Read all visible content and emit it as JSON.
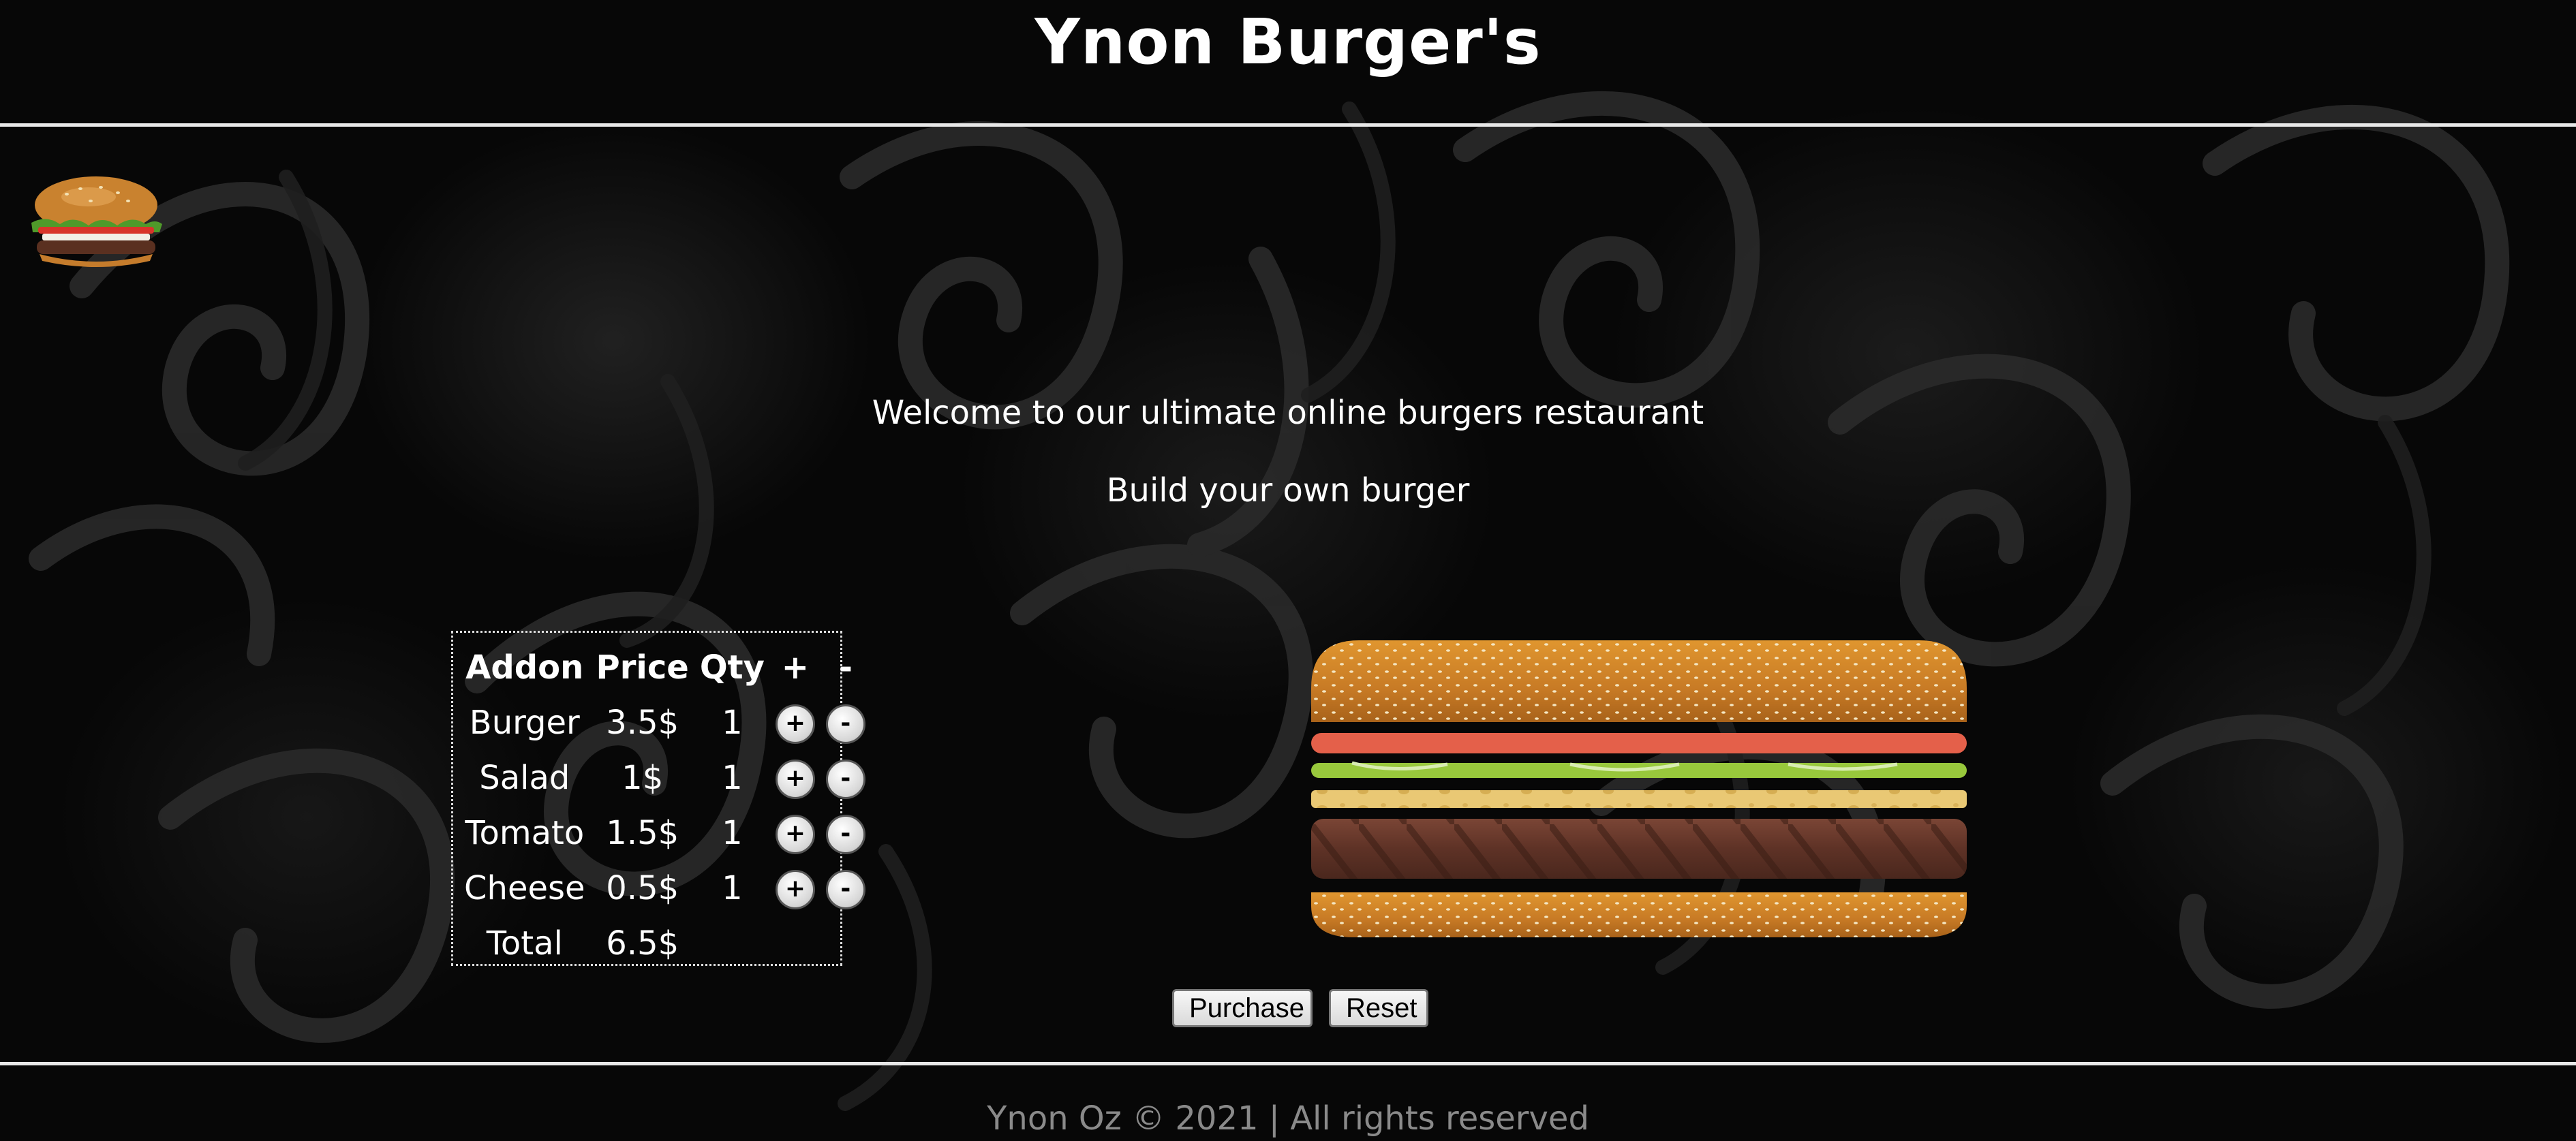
{
  "header": {
    "title": "Ynon Burger's"
  },
  "logo": {
    "icon": "burger-logo-icon"
  },
  "intro": {
    "welcome": "Welcome to our ultimate online burgers restaurant",
    "subtitle": "Build your own burger"
  },
  "order_table": {
    "headers": {
      "addon": "Addon",
      "price": "Price",
      "qty": "Qty",
      "plus": "+",
      "minus": "-"
    },
    "rows": [
      {
        "addon": "Burger",
        "price": "3.5$",
        "qty": "1",
        "plus": "+",
        "minus": "-"
      },
      {
        "addon": "Salad",
        "price": "1$",
        "qty": "1",
        "plus": "+",
        "minus": "-"
      },
      {
        "addon": "Tomato",
        "price": "1.5$",
        "qty": "1",
        "plus": "+",
        "minus": "-"
      },
      {
        "addon": "Cheese",
        "price": "0.5$",
        "qty": "1",
        "plus": "+",
        "minus": "-"
      }
    ],
    "total": {
      "label": "Total",
      "value": "6.5$"
    }
  },
  "burger_layers": [
    "top-bun",
    "tomato",
    "salad",
    "cheese",
    "patty",
    "bottom-bun"
  ],
  "colors": {
    "bun": "#d8892f",
    "tomato": "#e4604a",
    "salad": "#98c83c",
    "cheese": "#e9c874",
    "patty": "#6b3b2e"
  },
  "actions": {
    "purchase": "Purchase",
    "reset": "Reset"
  },
  "footer": {
    "text": "Ynon Oz © 2021 | All rights reserved"
  }
}
